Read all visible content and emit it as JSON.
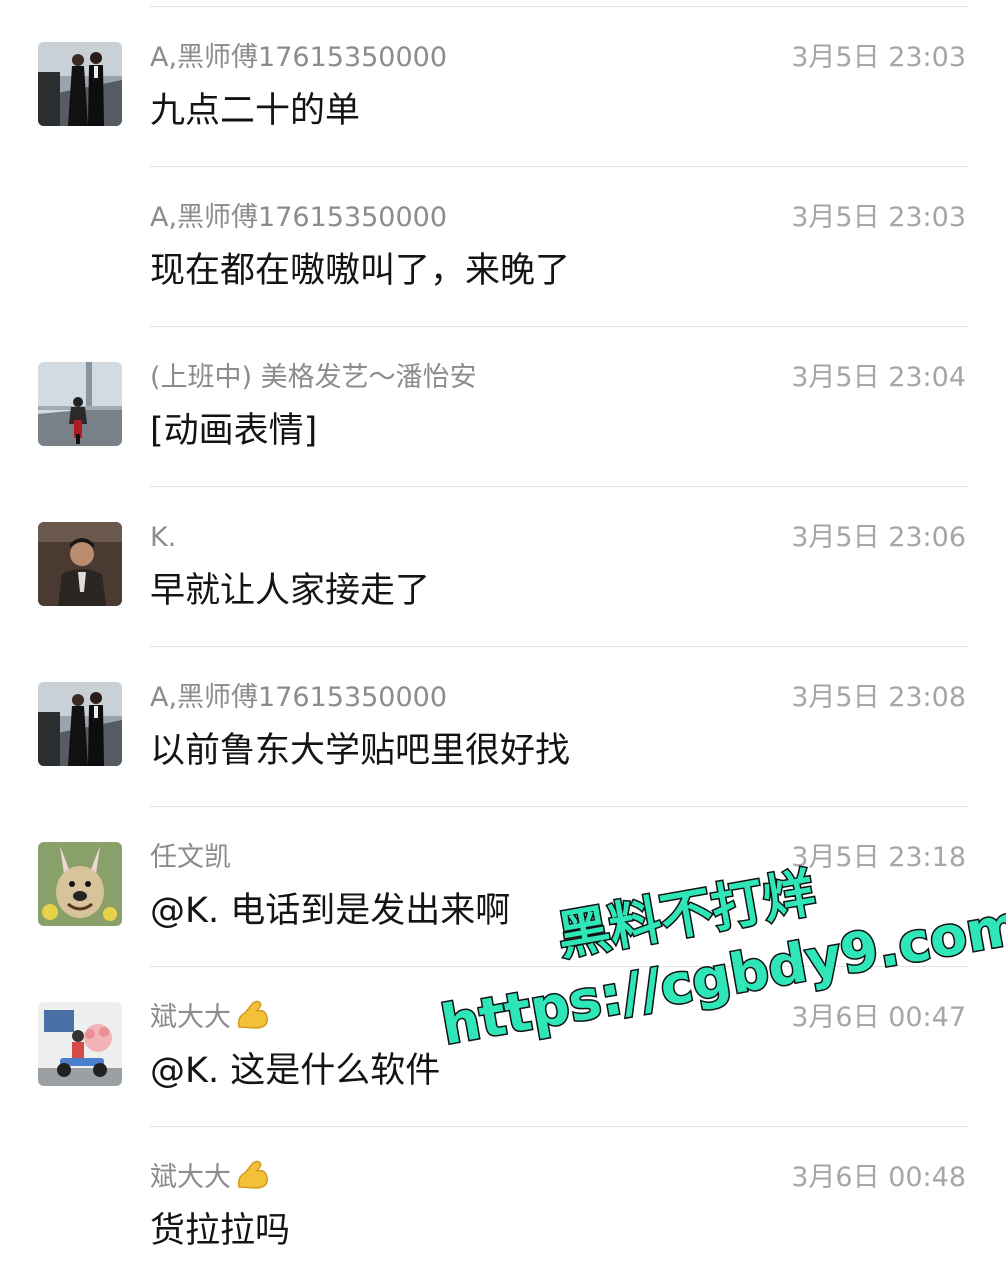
{
  "messages": [
    {
      "sender": "A,黑师傅17615350000",
      "time": "3月5日 23:03",
      "text": "九点二十的单",
      "avatar": "couple-photo",
      "show_avatar": true,
      "emoji": null
    },
    {
      "sender": "A,黑师傅17615350000",
      "time": "3月5日 23:03",
      "text": "现在都在嗷嗷叫了，来晚了",
      "avatar": null,
      "show_avatar": false,
      "emoji": null
    },
    {
      "sender": "(上班中) 美格发艺～潘怡安",
      "time": "3月5日 23:04",
      "text": "[动画表情]",
      "avatar": "motorcycle-bridge-photo",
      "show_avatar": true,
      "emoji": null
    },
    {
      "sender": "K.",
      "time": "3月5日 23:06",
      "text": "早就让人家接走了",
      "avatar": "man-portrait-photo",
      "show_avatar": true,
      "emoji": null
    },
    {
      "sender": "A,黑师傅17615350000",
      "time": "3月5日 23:08",
      "text": "以前鲁东大学贴吧里很好找",
      "avatar": "couple-photo",
      "show_avatar": true,
      "emoji": null
    },
    {
      "sender": "任文凯",
      "time": "3月5日 23:18",
      "text": "@K. 电话到是发出来啊",
      "avatar": "dog-bunny-ears-photo",
      "show_avatar": true,
      "emoji": null
    },
    {
      "sender": "斌大大",
      "time": "3月6日 00:47",
      "text": "@K. 这是什么软件",
      "avatar": "scooter-delivery-illustration",
      "show_avatar": true,
      "emoji": "flexed-biceps-icon"
    },
    {
      "sender": "斌大大",
      "time": "3月6日 00:48",
      "text": "货拉拉吗",
      "avatar": null,
      "show_avatar": false,
      "emoji": "flexed-biceps-icon"
    }
  ],
  "watermark": {
    "line1": "黑料不打烊",
    "line2": "https://cgbdy9.com",
    "fill_color": "#2ee6b8",
    "outline_color": "#111111"
  },
  "colors": {
    "sender": "#8c8c8c",
    "time": "#a6a6a6",
    "message": "#141414",
    "divider": "#e2e2e2"
  }
}
